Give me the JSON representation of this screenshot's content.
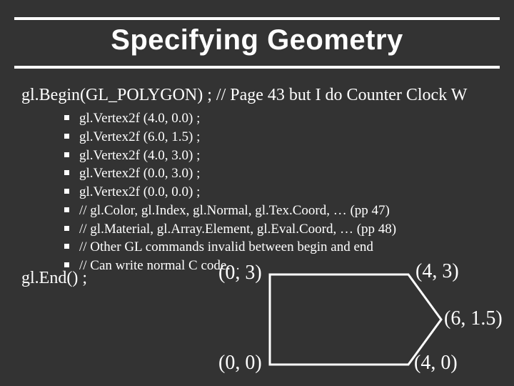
{
  "title": "Specifying Geometry",
  "code": {
    "begin": "gl.Begin(GL_POLYGON) ; // Page 43 but I do Counter Clock W",
    "bullets": [
      "gl.Vertex2f (4.0, 0.0) ;",
      "gl.Vertex2f (6.0, 1.5) ;",
      "gl.Vertex2f (4.0, 3.0) ;",
      "gl.Vertex2f (0.0, 3.0) ;",
      "gl.Vertex2f (0.0, 0.0) ;",
      "// gl.Color, gl.Index, gl.Normal, gl.Tex.Coord, … (pp 47)",
      "// gl.Material, gl.Array.Element, gl.Eval.Coord, … (pp 48)",
      "// Other GL commands invalid between begin and end",
      "// Can write normal C code…"
    ],
    "end": "gl.End() ;"
  },
  "diagram": {
    "labels": {
      "top_left": "(0, 3)",
      "top_right": "(4, 3)",
      "right": "(6, 1.5)",
      "bottom_left": "(0, 0)",
      "bottom_right": "(4, 0)"
    }
  }
}
